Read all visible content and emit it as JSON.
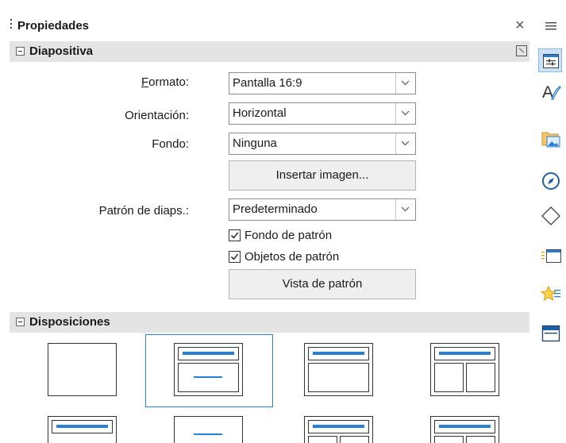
{
  "panel": {
    "title": "Propiedades"
  },
  "sections": {
    "slide": {
      "title": "Diapositiva",
      "format_label_hotkey": "F",
      "format_label_rest": "ormato:",
      "format_value": "Pantalla 16:9",
      "orientation_label": "Orientación:",
      "orientation_value": "Horizontal",
      "background_label": "Fondo:",
      "background_value": "Ninguna",
      "insert_image_button": "Insertar imagen...",
      "master_label": "Patrón de diaps.:",
      "master_value": "Predeterminado",
      "master_background_checkbox": "Fondo de patrón",
      "master_background_checked": true,
      "master_objects_checkbox": "Objetos de patrón",
      "master_objects_checked": true,
      "master_view_button": "Vista de patrón"
    },
    "layouts": {
      "title": "Disposiciones"
    }
  },
  "colors": {
    "accent": "#2a7fd4",
    "layout_blue": "#2a7fd4",
    "section_bg": "#e4e4e4"
  },
  "icons": {
    "menu": "hamburger-icon",
    "tabs": [
      "properties-icon",
      "styles-icon",
      "gallery-icon",
      "navigator-icon",
      "shapes-icon",
      "slide-transition-icon",
      "animation-icon",
      "master-slides-icon"
    ]
  }
}
